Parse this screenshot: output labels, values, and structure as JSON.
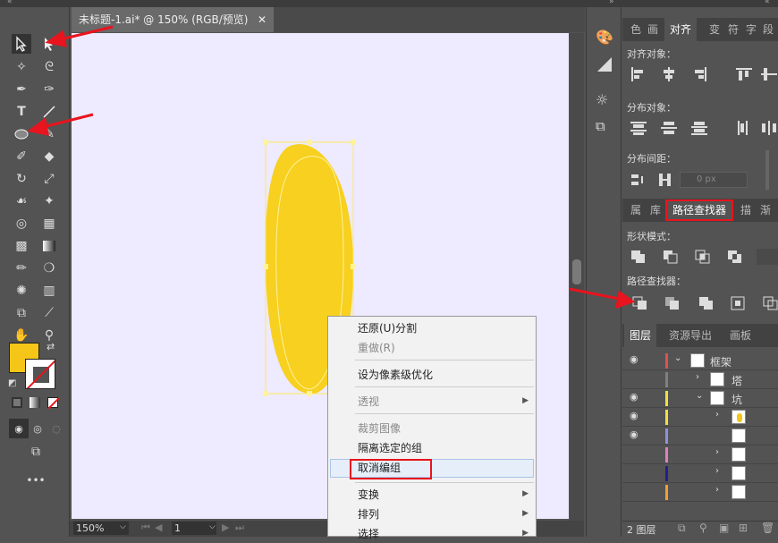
{
  "document": {
    "tab_title": "未标题-1.ai* @ 150% (RGB/预览)",
    "close": "✕"
  },
  "status": {
    "zoom": "150%",
    "artboard_num": "1"
  },
  "panels": {
    "top_tabs": [
      "色",
      "画",
      "对齐",
      "变",
      "符",
      "字",
      "段"
    ],
    "align_objects_label": "对齐对象：",
    "distribute_objects_label": "分布对象：",
    "distribute_spacing_label": "分布间距：",
    "spacing_value": "0 px",
    "mid_tabs": [
      "属",
      "库",
      "路径查找器",
      "描",
      "渐"
    ],
    "shape_modes_label": "形状模式：",
    "pathfinders_label": "路径查找器：",
    "layers_tabs": [
      "图层",
      "资源导出",
      "画板"
    ],
    "layers": [
      {
        "name": "框架",
        "color": "#e05050"
      },
      {
        "name": "塔",
        "color": "#808080"
      },
      {
        "name": "坑",
        "color": "#f0e040"
      },
      {
        "name": "",
        "color": "#f0e040"
      },
      {
        "name": "",
        "color": "#9090e0"
      },
      {
        "name": "",
        "color": "#e080c0"
      },
      {
        "name": "",
        "color": "#202090"
      },
      {
        "name": "",
        "color": "#f0a030"
      }
    ],
    "layer_count": "2 图层"
  },
  "context_menu": {
    "items": [
      {
        "label": "还原(U)分割",
        "disabled": false
      },
      {
        "label": "重做(R)",
        "disabled": true
      },
      {
        "label": "设为像素级优化",
        "disabled": false
      },
      {
        "label": "透视",
        "disabled": true
      },
      {
        "label": "裁剪图像",
        "disabled": true
      },
      {
        "label": "隔离选定的组",
        "disabled": false
      },
      {
        "label": "取消编组",
        "disabled": false
      },
      {
        "label": "变换",
        "disabled": false
      },
      {
        "label": "排列",
        "disabled": false
      },
      {
        "label": "选择",
        "disabled": false
      }
    ]
  },
  "colors": {
    "fill": "#f5c518",
    "artboard": "#eeeaff",
    "annotation": "#e8141e",
    "shape": "#f7d020"
  }
}
